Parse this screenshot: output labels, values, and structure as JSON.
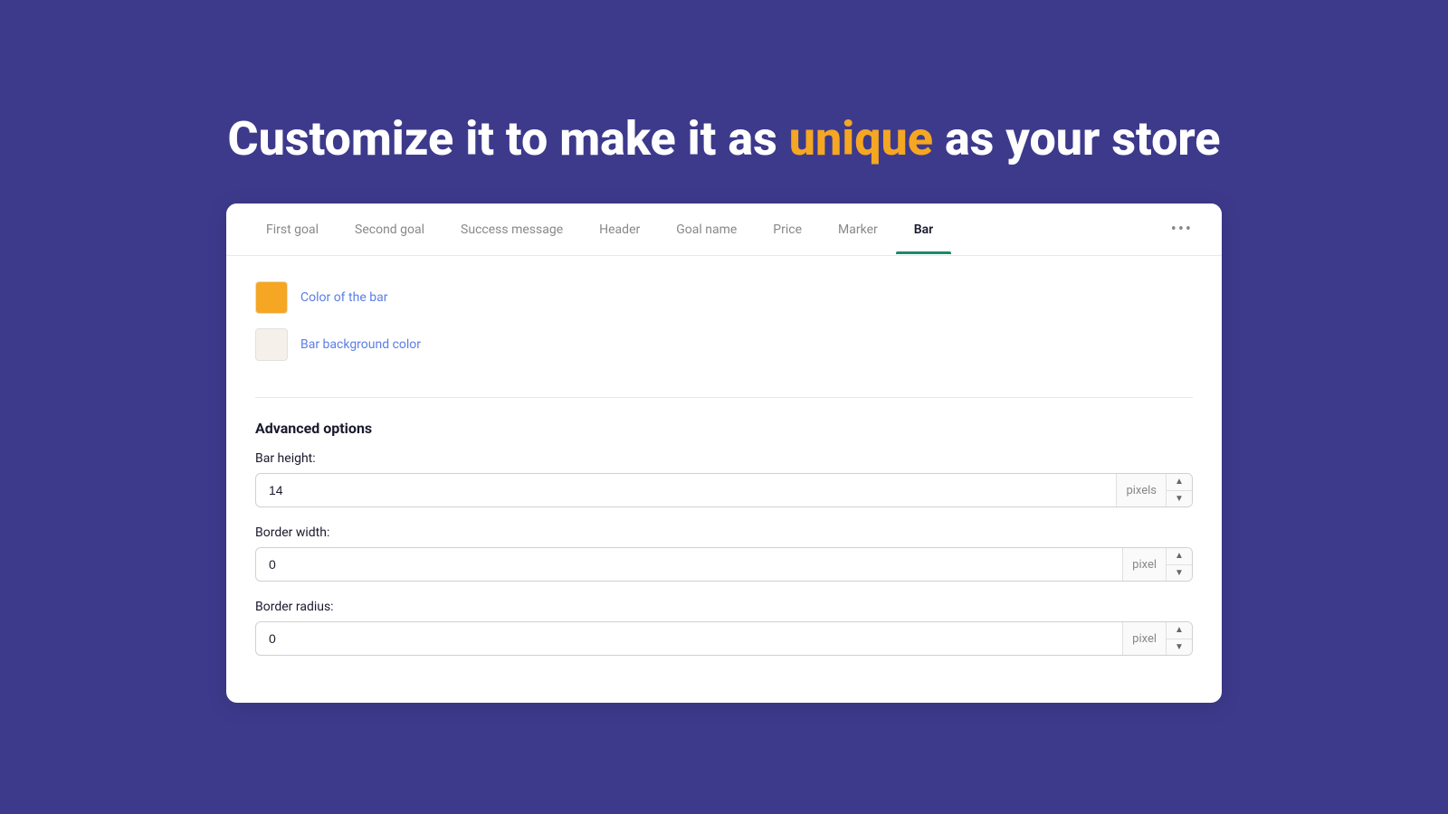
{
  "headline": {
    "prefix": "Customize it to make it as ",
    "accent": "unique",
    "suffix": " as your store"
  },
  "tabs": {
    "items": [
      {
        "label": "First goal",
        "active": false
      },
      {
        "label": "Second goal",
        "active": false
      },
      {
        "label": "Success message",
        "active": false
      },
      {
        "label": "Header",
        "active": false
      },
      {
        "label": "Goal name",
        "active": false
      },
      {
        "label": "Price",
        "active": false
      },
      {
        "label": "Marker",
        "active": false
      },
      {
        "label": "Bar",
        "active": true
      }
    ],
    "more_label": "•••"
  },
  "color_section": {
    "bar_color_label": "Color of the bar",
    "bar_color_value": "#f5a623",
    "bg_color_label": "Bar background color",
    "bg_color_value": "#f5f0ea"
  },
  "advanced": {
    "title": "Advanced options",
    "fields": [
      {
        "label": "Bar height:",
        "value": "14",
        "unit": "pixels"
      },
      {
        "label": "Border width:",
        "value": "0",
        "unit": "pixel"
      },
      {
        "label": "Border radius:",
        "value": "0",
        "unit": "pixel"
      }
    ]
  }
}
